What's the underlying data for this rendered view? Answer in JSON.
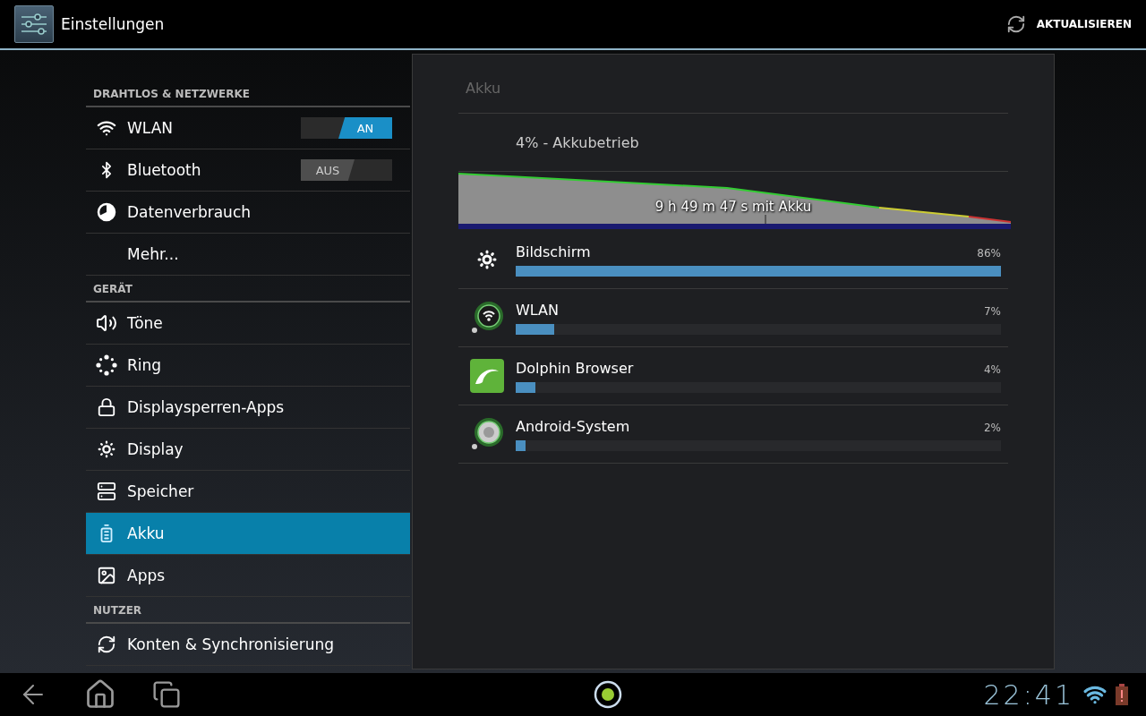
{
  "action_bar": {
    "title": "Einstellungen",
    "action": "AKTUALISIEREN"
  },
  "sidebar": {
    "sections": [
      {
        "header": "DRAHTLOS & NETZWERKE",
        "items": [
          {
            "label": "WLAN",
            "kind": "toggle",
            "on": true,
            "switch_label": "AN",
            "selected": false
          },
          {
            "label": "Bluetooth",
            "kind": "toggle",
            "on": false,
            "switch_label": "AUS",
            "selected": false
          },
          {
            "label": "Datenverbrauch",
            "kind": "link",
            "selected": false
          },
          {
            "label": "Mehr...",
            "kind": "link",
            "selected": false
          }
        ]
      },
      {
        "header": "GERÄT",
        "items": [
          {
            "label": "Töne",
            "kind": "link",
            "selected": false
          },
          {
            "label": "Ring",
            "kind": "link",
            "selected": false
          },
          {
            "label": "Displaysperren-Apps",
            "kind": "link",
            "selected": false
          },
          {
            "label": "Display",
            "kind": "link",
            "selected": false
          },
          {
            "label": "Speicher",
            "kind": "link",
            "selected": false
          },
          {
            "label": "Akku",
            "kind": "link",
            "selected": true
          },
          {
            "label": "Apps",
            "kind": "link",
            "selected": false
          }
        ]
      },
      {
        "header": "NUTZER",
        "items": [
          {
            "label": "Konten & Synchronisierung",
            "kind": "link",
            "selected": false
          }
        ]
      }
    ]
  },
  "detail": {
    "title": "Akku",
    "status": "4% - Akkubetrieb",
    "graph_label": "9 h 49 m 47 s mit Akku",
    "usage": [
      {
        "name": "Bildschirm",
        "percent": "86%",
        "level": 1
      },
      {
        "name": "WLAN",
        "percent": "7%",
        "level": 0.08
      },
      {
        "name": "Dolphin Browser",
        "percent": "4%",
        "level": 0.04
      },
      {
        "name": "Android-System",
        "percent": "2%",
        "level": 0.02
      }
    ]
  },
  "nav_bar": {
    "time": "22:41"
  }
}
